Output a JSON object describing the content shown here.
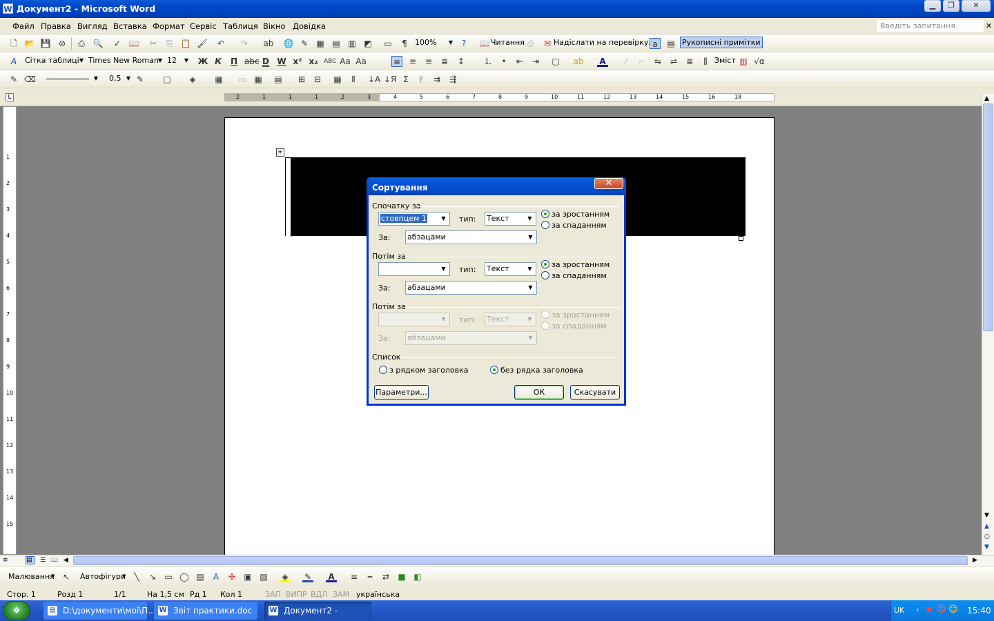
{
  "window": {
    "title": "Документ2 - Microsoft Word",
    "app_icon": "W"
  },
  "menu": {
    "items": [
      "Файл",
      "Правка",
      "Вигляд",
      "Вставка",
      "Формат",
      "Сервіс",
      "Таблиця",
      "Вікно",
      "Довідка"
    ],
    "ask_placeholder": "Введіть запитання"
  },
  "toolbar_standard": {
    "zoom": "100%",
    "reading": "Читання",
    "send_review": "Надіслати на перевірку…",
    "handwritten": "Рукописні примітки"
  },
  "toolbar_format": {
    "style": "Сітка таблиці",
    "font": "Times New Roman",
    "size": "12",
    "toc": "Зміст"
  },
  "toolbar_tables": {
    "line_weight": "0,5"
  },
  "ruler": {
    "h_labels": [
      "2",
      "1",
      "1",
      "1",
      "2",
      "3",
      "4",
      "5",
      "6",
      "7",
      "8",
      "9",
      "10",
      "11",
      "12",
      "13",
      "14",
      "15",
      "16",
      "18"
    ]
  },
  "drawing": {
    "draw": "Малювання",
    "autoshapes": "Автофігури"
  },
  "status": {
    "page": "Стор. 1",
    "section": "Розд 1",
    "pages": "1/1",
    "at": "На 1,5 см",
    "line": "Рд 1",
    "col": "Кол 1",
    "rec": "ЗАП",
    "trk": "ВИПР",
    "ext": "ВДЛ",
    "ovr": "ЗАМ",
    "lang": "українська"
  },
  "taskbar": {
    "items": [
      "D:\\документи\\мої\\П...",
      "Звіт практики.doc - ...",
      "Документ2 - Micros..."
    ],
    "lang": "UK",
    "time": "15:40"
  },
  "dialog": {
    "title": "Сортування",
    "sort1": {
      "group": "Спочатку за",
      "field": "стовпцем 1",
      "type_label": "тип:",
      "type": "Текст",
      "by_label": "За:",
      "by": "абзацами",
      "asc": "за зростанням",
      "desc": "за спаданням"
    },
    "sort2": {
      "group": "Потім за",
      "field": "",
      "type_label": "тип:",
      "type": "Текст",
      "by_label": "За:",
      "by": "абзацами",
      "asc": "за зростанням",
      "desc": "за спаданням"
    },
    "sort3": {
      "group": "Потім за",
      "field": "",
      "type_label": "тип:",
      "type": "Текст",
      "by_label": "За:",
      "by": "абзацами",
      "asc": "за зростанням",
      "desc": "за спаданням"
    },
    "list": {
      "group": "Список",
      "with_header": "з рядком заголовка",
      "no_header": "без рядка заголовка"
    },
    "buttons": {
      "params": "Параметри...",
      "ok": "ОК",
      "cancel": "Скасувати"
    }
  },
  "colors": {
    "titlebar": "#0048c8",
    "dialog_border": "#0831d9",
    "selection": "#316ac5",
    "radio_dot": "#21a121"
  }
}
